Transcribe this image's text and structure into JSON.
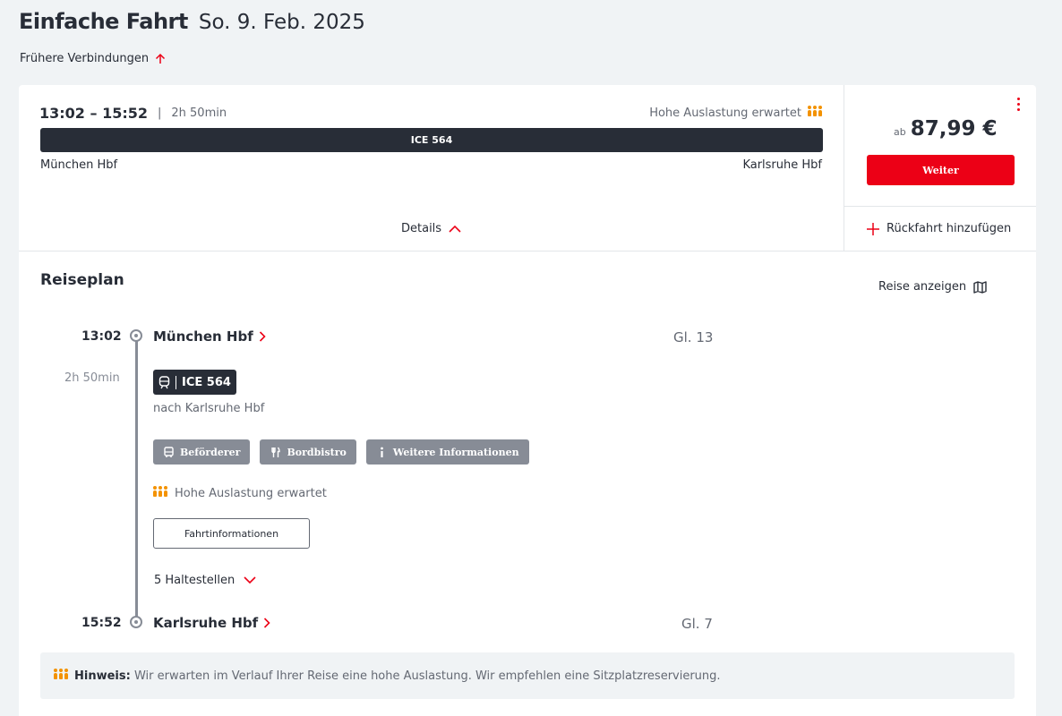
{
  "header": {
    "title": "Einfache Fahrt",
    "date": "So. 9. Feb. 2025",
    "earlier_connections": "Frühere Verbindungen"
  },
  "connection": {
    "times": "13:02 – 15:52",
    "separator": "|",
    "duration": "2h 50min",
    "occupancy": "Hohe Auslastung erwartet",
    "train": "ICE 564",
    "from": "München Hbf",
    "to": "Karlsruhe Hbf",
    "details_label": "Details"
  },
  "offer": {
    "price_prefix": "ab",
    "price": "87,99 €",
    "continue_label": "Weiter",
    "add_return_label": "Rückfahrt hinzufügen"
  },
  "itinerary": {
    "title": "Reiseplan",
    "show_trip_label": "Reise anzeigen",
    "departure": {
      "time": "13:02",
      "station": "München Hbf",
      "track": "Gl. 13"
    },
    "duration": "2h 50min",
    "train": "ICE 564",
    "direction": "nach Karlsruhe Hbf",
    "chips": {
      "operator": "Beförderer",
      "bistro": "Bordbistro",
      "more_info": "Weitere Informationen"
    },
    "occupancy": "Hohe Auslastung erwartet",
    "trip_info_label": "Fahrtinformationen",
    "stops_label": "5 Haltestellen",
    "arrival": {
      "time": "15:52",
      "station": "Karlsruhe Hbf",
      "track": "Gl. 7"
    }
  },
  "notice": {
    "label": "Hinweis:",
    "text": "Wir erwarten im Verlauf Ihrer Reise eine hohe Auslastung. Wir empfehlen eine Sitzplatzreservierung."
  },
  "colors": {
    "accent_red": "#ec0016",
    "dark": "#282d37",
    "occupancy_orange": "#f39200",
    "chip_gray": "#878c96"
  }
}
